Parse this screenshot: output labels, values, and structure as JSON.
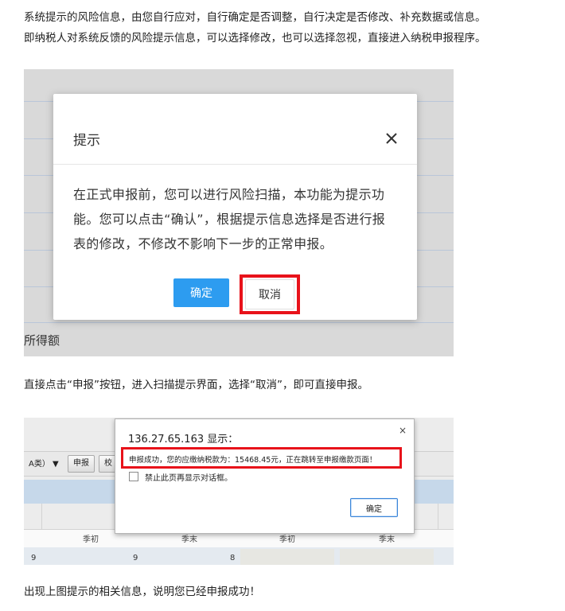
{
  "paragraphs": {
    "p1_line1": "系统提示的风险信息，由您自行应对，自行确定是否调整，自行决定是否修改、补充数据或信息。",
    "p1_line2": "即纳税人对系统反馈的风险提示信息，可以选择修改，也可以选择忽视，直接进入纳税申报程序。",
    "p2": "直接点击“申报”按钮，进入扫描提示界面，选择“取消”，即可直接申报。",
    "p3": "出现上图提示的相关信息，说明您已经申报成功！"
  },
  "screenshot1": {
    "background_label": "所得额",
    "dialog": {
      "title": "提示",
      "close_icon": "close-icon",
      "body": "在正式申报前，您可以进行风险扫描，本功能为提示功能。您可以点击“确认”，根据提示信息选择是否进行报表的修改，不修改不影响下一步的正常申报。",
      "confirm_label": "确定",
      "cancel_label": "取消"
    },
    "highlight_color": "#e8121a",
    "confirm_color": "#2d9cf0"
  },
  "screenshot2": {
    "toolbar": {
      "type_select": "A类） ▼",
      "declare_button": "申报",
      "partial_button": "校"
    },
    "table_headers": [
      "季初",
      "季末",
      "季初",
      "季末"
    ],
    "row_values": [
      "9",
      "8"
    ],
    "dialog": {
      "title": "136.27.65.163 显示：",
      "close_label": "×",
      "message": "申报成功，您的应缴纳税款为：15468.45元，正在跳转至申报缴款页面！",
      "checkbox_label": "禁止此页再显示对话框。",
      "ok_label": "确定"
    }
  }
}
